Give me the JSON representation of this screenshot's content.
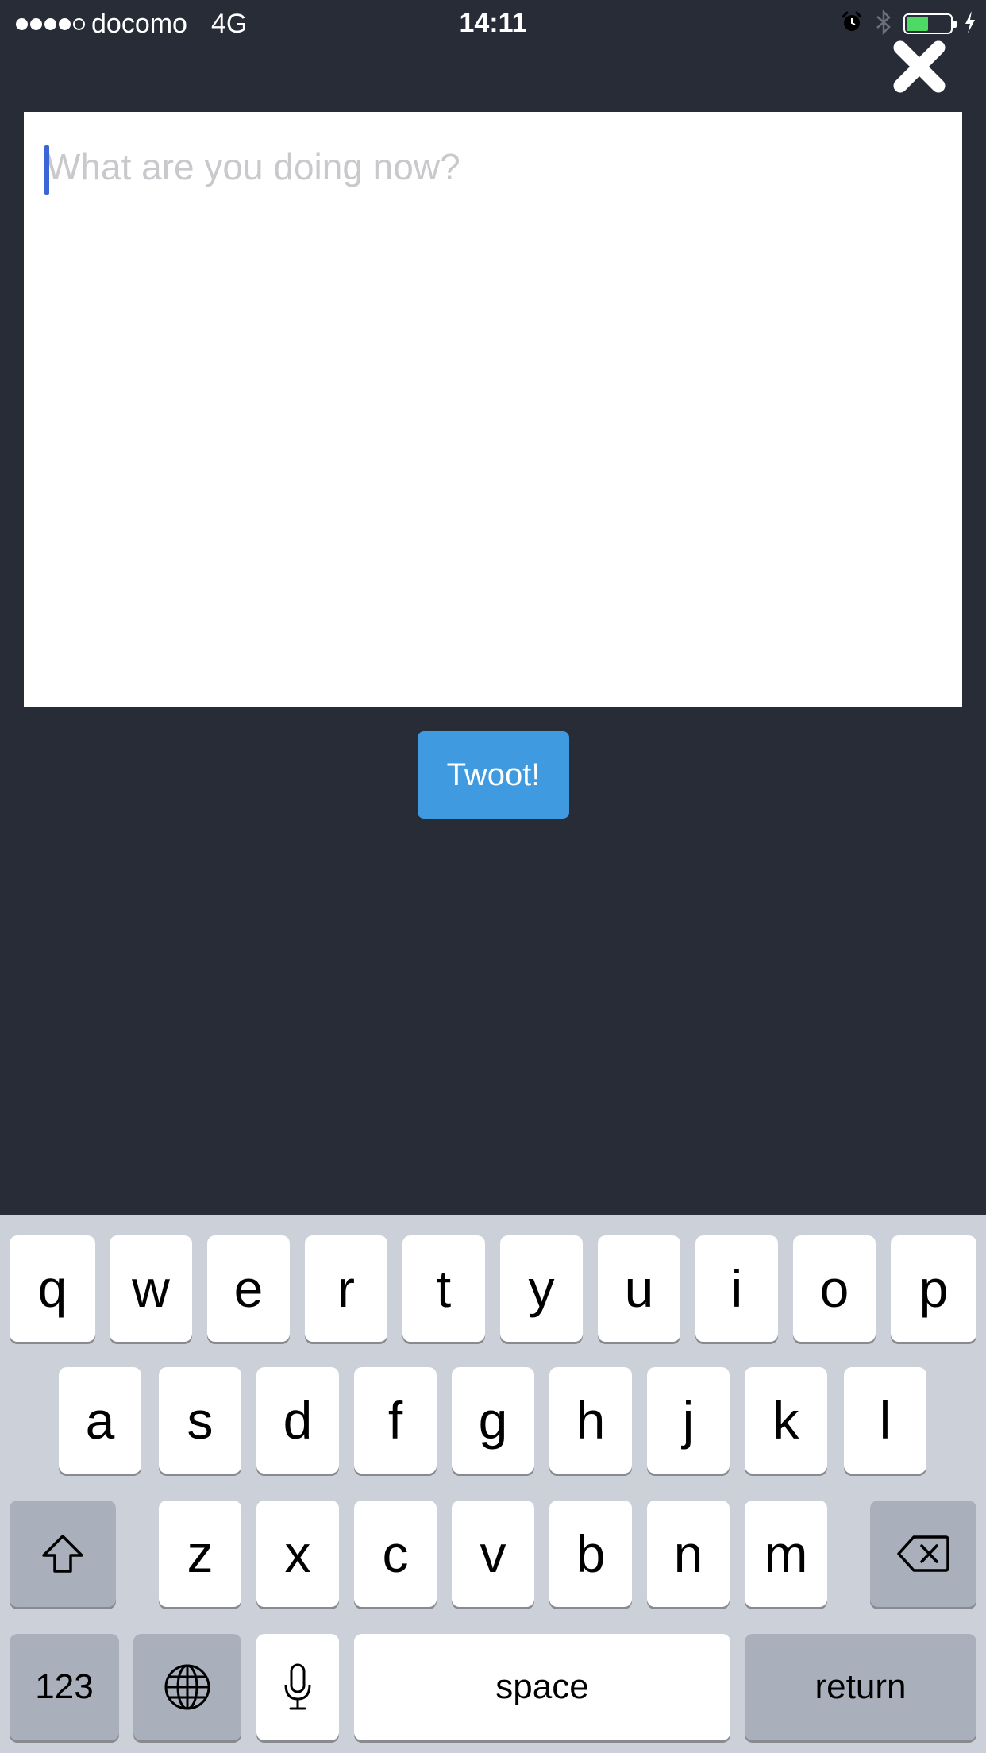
{
  "status_bar": {
    "carrier": "docomo",
    "network": "4G",
    "time": "14:11",
    "signal_bars_filled": 4,
    "signal_bars_total": 5,
    "battery_level": 0.5,
    "battery_color": "#4cd964",
    "icons": [
      "alarm-icon",
      "bluetooth-icon",
      "battery-icon",
      "charging-icon"
    ]
  },
  "header": {
    "close_icon": "close-icon"
  },
  "compose": {
    "placeholder": "What are you doing now?",
    "value": "",
    "submit_label": "Twoot!",
    "submit_color": "#3f9ae0"
  },
  "keyboard": {
    "row1": [
      "q",
      "w",
      "e",
      "r",
      "t",
      "y",
      "u",
      "i",
      "o",
      "p"
    ],
    "row2": [
      "a",
      "s",
      "d",
      "f",
      "g",
      "h",
      "j",
      "k",
      "l"
    ],
    "row3": [
      "z",
      "x",
      "c",
      "v",
      "b",
      "n",
      "m"
    ],
    "shift_icon": "shift-icon",
    "delete_icon": "delete-icon",
    "numbers_label": "123",
    "globe_icon": "globe-icon",
    "mic_icon": "microphone-icon",
    "space_label": "space",
    "return_label": "return"
  },
  "theme": {
    "background": "#282c37",
    "keyboard_background": "#ccd0d8"
  }
}
